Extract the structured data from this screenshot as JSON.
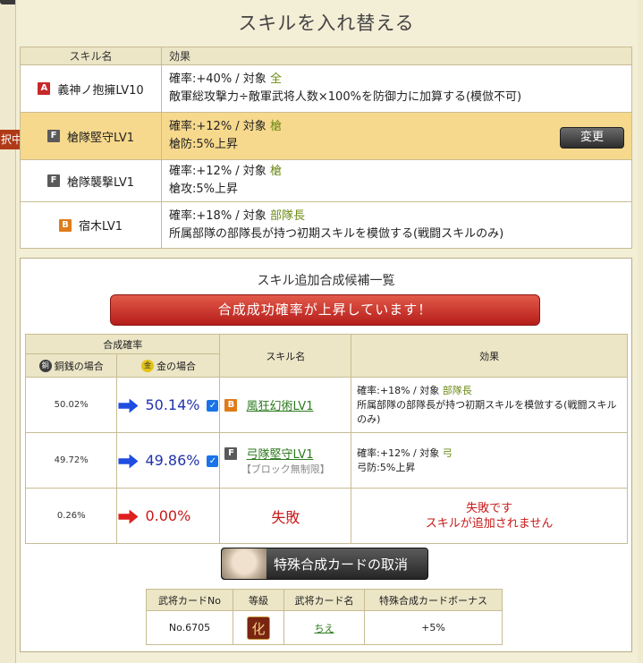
{
  "title": "スキルを入れ替える",
  "skills_table": {
    "headers": [
      "スキル名",
      "効果"
    ],
    "rows": [
      {
        "rank": "A",
        "name": "義神ノ抱擁LV10",
        "line1": "確率:+40%  /  対象",
        "target": "全",
        "line2": "敵軍総攻撃力÷敵軍武将人数×100%を防御力に加算する(模倣不可)"
      },
      {
        "rank": "F",
        "name": "槍隊堅守LV1",
        "line1": "確率:+12%  /  対象",
        "target": "槍",
        "line2": "槍防:5%上昇"
      },
      {
        "rank": "F",
        "name": "槍隊襲撃LV1",
        "line1": "確率:+12%  /  対象",
        "target": "槍",
        "line2": "槍攻:5%上昇"
      },
      {
        "rank": "B",
        "name": "宿木LV1",
        "line1": "確率:+18%  /  対象",
        "target": "部隊長",
        "line2": "所属部隊の部隊長が持つ初期スキルを模倣する(戦闘スキルのみ)"
      }
    ],
    "selected_tag": "択中",
    "change_button": "変更"
  },
  "candidates": {
    "title": "スキル追加合成候補一覧",
    "notice": "合成成功確率が上昇しています！",
    "headers": {
      "rate": "合成確率",
      "copper": "銅銭の場合",
      "gold": "金の場合",
      "name": "スキル名",
      "effect": "効果"
    },
    "coin_icons": {
      "copper": "銅",
      "gold": "金"
    },
    "rows": [
      {
        "copper_rate": "50.02%",
        "gold_rate": "50.14%",
        "rank": "B",
        "name": "風狂幻術LV1",
        "blocked": "",
        "effect_line1": "確率:+18%  /  対象",
        "target": "部隊長",
        "effect_line2": "所属部隊の部隊長が持つ初期スキルを模倣する(戦闘スキルのみ)"
      },
      {
        "copper_rate": "49.72%",
        "gold_rate": "49.86%",
        "rank": "F",
        "name": "弓隊堅守LV1",
        "blocked": "【ブロック無制限】",
        "effect_line1": "確率:+12%  /  対象",
        "target": "弓",
        "effect_line2": "弓防:5%上昇"
      }
    ],
    "fail": {
      "copper_rate": "0.26%",
      "gold_rate": "0.00%",
      "name": "失敗",
      "effect_line1": "失敗です",
      "effect_line2": "スキルが追加されません"
    },
    "check_mark": "✓"
  },
  "cancel_button": "特殊合成カードの取消",
  "card_table": {
    "headers": [
      "武将カードNo",
      "等級",
      "武将カード名",
      "特殊合成カードボーナス"
    ],
    "no": "No.6705",
    "grade": "化",
    "name": "ちえ",
    "bonus": "+5%"
  },
  "colors": {
    "accent_red": "#c81818",
    "target_green": "#6c8a16",
    "link_green": "#2a7a1c",
    "selected_row": "#f7d98d"
  }
}
